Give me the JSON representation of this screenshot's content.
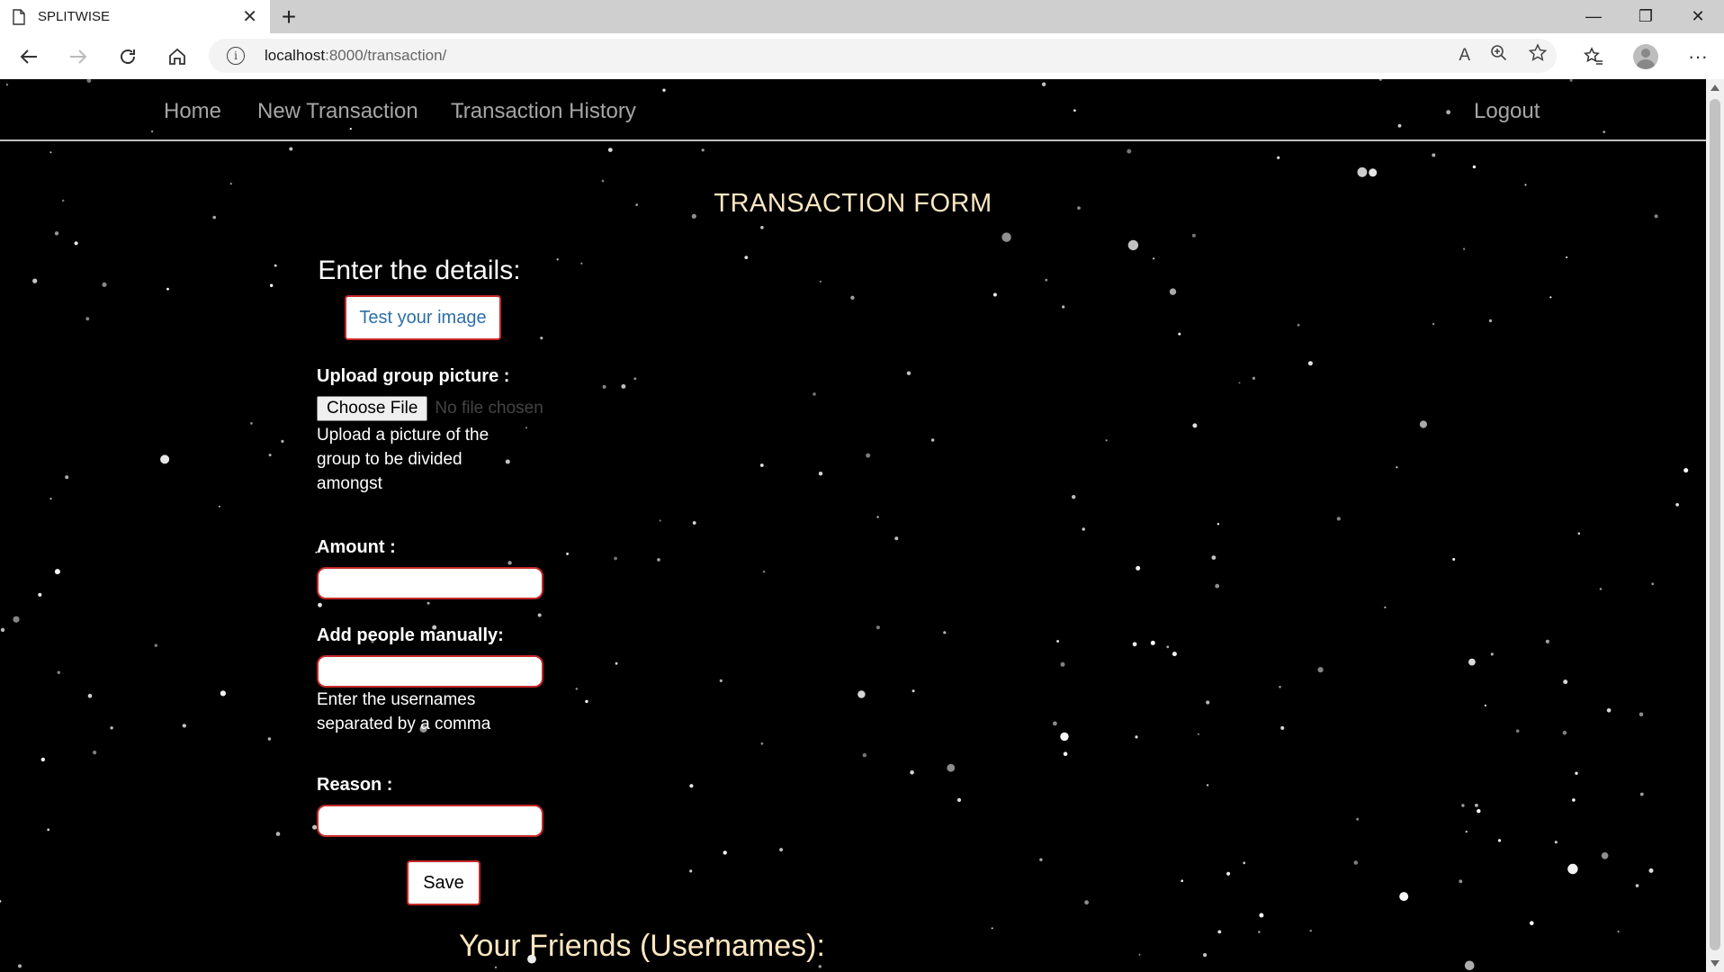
{
  "browser": {
    "tab_title": "SPLITWISE",
    "tab_close": "✕",
    "new_tab": "+",
    "url_host": "localhost",
    "url_rest": ":8000/transaction/",
    "window_minimize": "—",
    "window_restore": "❐",
    "window_close": "✕"
  },
  "site_nav": {
    "home": "Home",
    "new_transaction": "New Transaction",
    "transaction_history": "Transaction History",
    "logout": "Logout"
  },
  "page": {
    "title": "TRANSACTION FORM",
    "enter_details": "Enter the details:",
    "test_image_button": "Test your image",
    "upload_label": "Upload group picture :",
    "choose_file_button": "Choose File",
    "no_file_text": "No file chosen",
    "upload_help_1": "Upload a picture of the",
    "upload_help_2": "group to be divided",
    "upload_help_3": "amongst",
    "amount_label": "Amount :",
    "amount_value": "",
    "people_label": "Add people manually:",
    "people_value": "",
    "people_help_1": "Enter the usernames",
    "people_help_2": "separated by a comma",
    "reason_label": "Reason :",
    "reason_value": "",
    "save_button": "Save",
    "friends_title": "Your Friends (Usernames):"
  },
  "colors": {
    "background": "#000000",
    "title_color": "#fde7c1",
    "nav_link": "#a6a6a6",
    "input_border": "#c62828",
    "button_text_blue": "#2c6fa8"
  }
}
